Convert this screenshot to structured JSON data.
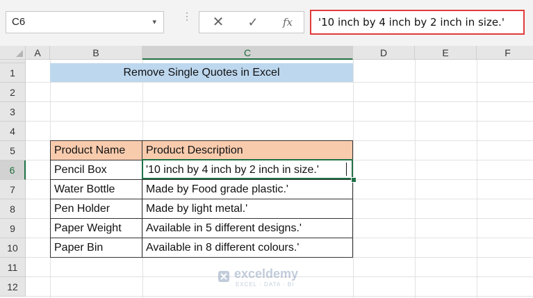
{
  "formula_bar": {
    "name_box": "C6",
    "name_box_dropdown": "▾",
    "cancel_glyph": "✕",
    "enter_glyph": "✓",
    "fx_label": "fx",
    "content": "'10 inch by 4 inch by 2 inch in size.'"
  },
  "columns": [
    "A",
    "B",
    "C",
    "D",
    "E",
    "F"
  ],
  "rows": [
    "1",
    "2",
    "3",
    "4",
    "5",
    "6",
    "7",
    "8",
    "9",
    "10",
    "11",
    "12"
  ],
  "selected": {
    "column": "C",
    "row": "6"
  },
  "sheet": {
    "title": "Remove Single Quotes in Excel",
    "headers": [
      "Product Name",
      "Product Description"
    ],
    "table": [
      [
        "Pencil Box",
        "'10 inch by 4 inch by 2 inch in size.'"
      ],
      [
        "Water Bottle",
        "Made by Food grade plastic.'"
      ],
      [
        "Pen Holder",
        "Made by light metal.'"
      ],
      [
        "Paper Weight",
        "Available in 5 different designs.'"
      ],
      [
        "Paper Bin",
        "Available in 8 different colours.'"
      ]
    ]
  },
  "watermark": {
    "name": "exceldemy",
    "tagline": "EXCEL · DATA · BI"
  },
  "colors": {
    "title_fill": "#bdd7ee",
    "header_fill": "#f8cbad",
    "selection": "#1e7145",
    "formula_highlight": "#e23a3a"
  }
}
